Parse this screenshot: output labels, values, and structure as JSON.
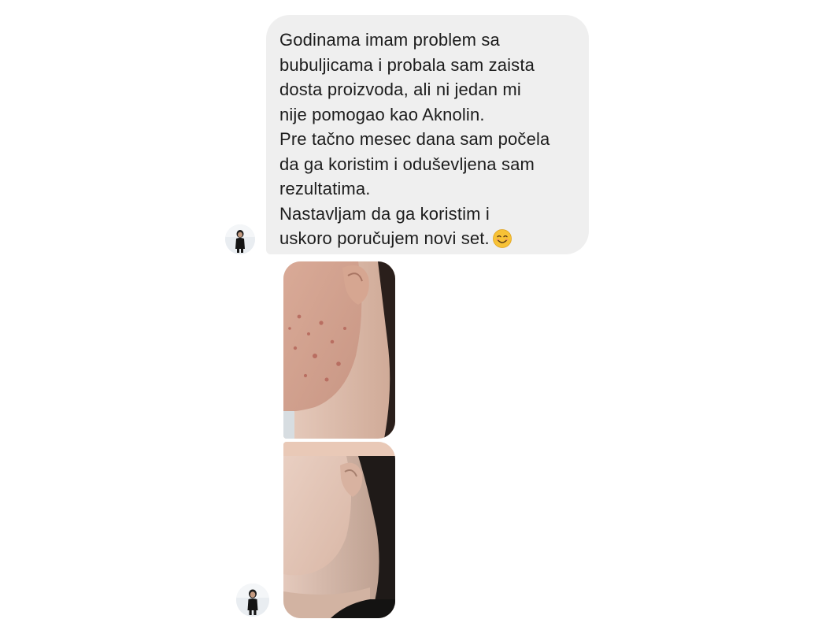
{
  "message": {
    "lines": [
      "Godinama imam problem sa",
      "bubuljicama i probala sam zaista",
      "dosta proizvoda, ali ni jedan mi",
      "nije pomogao kao Aknolin.",
      "Pre tačno mesec dana sam počela",
      "da ga koristim i oduševljena sam",
      "rezultatima.",
      "Nastavljam da ga koristim i",
      "uskoro poručujem novi set."
    ],
    "emoji": "smiling-face-emoji"
  },
  "photos": [
    {
      "icon": "before-photo-acne-cheek"
    },
    {
      "icon": "after-photo-clear-cheek"
    }
  ],
  "colors": {
    "bubble_bg": "#efefef",
    "text": "#1c1c1c",
    "emoji_face": "#f7c236"
  }
}
